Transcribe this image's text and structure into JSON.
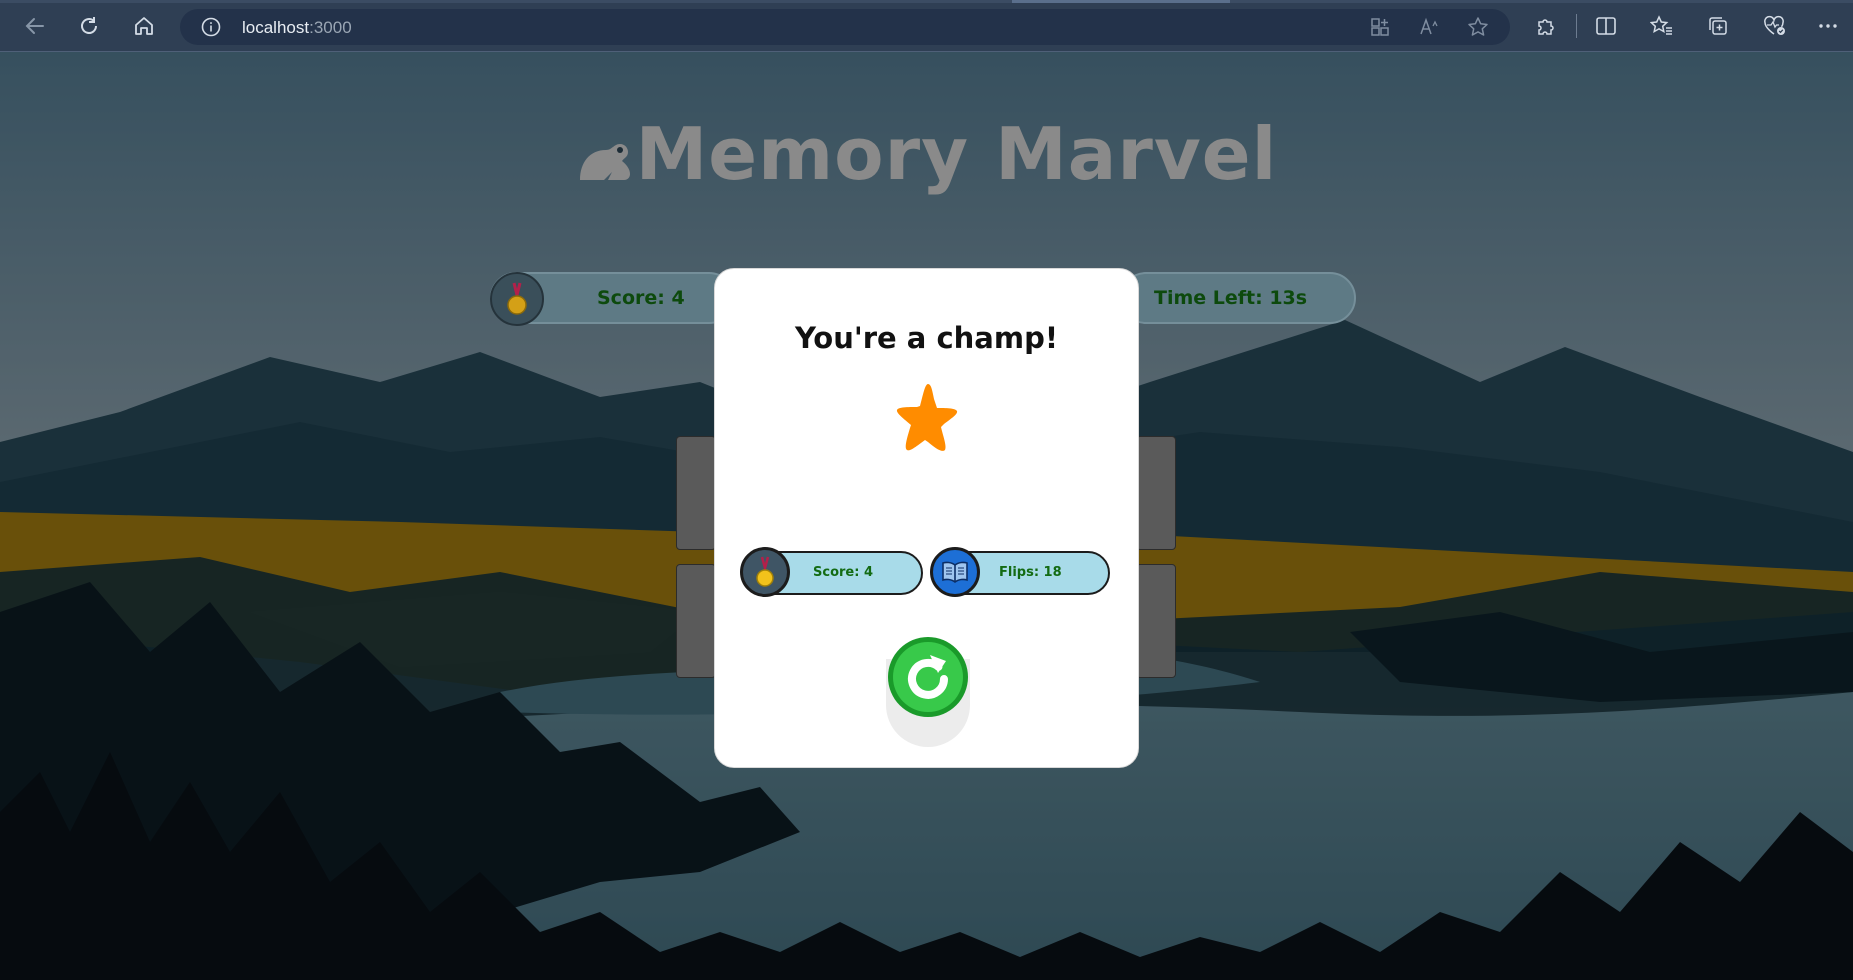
{
  "browser": {
    "address_host": "localhost",
    "address_port": ":3000"
  },
  "game": {
    "title": "Memory Marvel",
    "score_label": "Score: 4",
    "time_label": "Time Left: 13s"
  },
  "modal": {
    "title": "You're a champ!",
    "score_label": "Score: 4",
    "flips_label": "Flips: 18"
  },
  "colors": {
    "accent_green": "#136b13",
    "star_orange": "#ff8c00",
    "restart_green": "#2fbf3f",
    "pill_blue": "#a8dbe9"
  }
}
